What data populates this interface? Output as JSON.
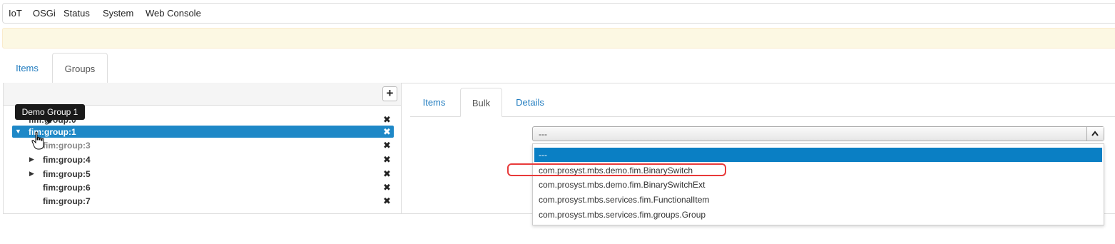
{
  "navbar": {
    "items": [
      {
        "label": "IoT"
      },
      {
        "label": "OSGi"
      },
      {
        "label": "Status"
      },
      {
        "label": "System"
      },
      {
        "label": "Web Console"
      }
    ]
  },
  "main_tabs": [
    {
      "label": "Items",
      "active": false
    },
    {
      "label": "Groups",
      "active": true
    }
  ],
  "tooltip": {
    "text": "Demo Group 1"
  },
  "tree": {
    "rows": [
      {
        "label": "fim:group:0",
        "expanded": false,
        "has_children": false
      },
      {
        "label": "fim:group:1",
        "expanded": true,
        "has_children": true,
        "selected": true
      },
      {
        "label": "fim:group:3",
        "has_children": false,
        "muted": true
      },
      {
        "label": "fim:group:4",
        "has_children": true
      },
      {
        "label": "fim:group:5",
        "has_children": true
      },
      {
        "label": "fim:group:6",
        "has_children": false
      },
      {
        "label": "fim:group:7",
        "has_children": false
      }
    ]
  },
  "sub_tabs": [
    {
      "label": "Items",
      "active": false
    },
    {
      "label": "Bulk",
      "active": true
    },
    {
      "label": "Details",
      "active": false
    }
  ],
  "select": {
    "value": "---"
  },
  "dropdown": {
    "options": [
      {
        "label": "---",
        "selected": true
      },
      {
        "label": "com.prosyst.mbs.demo.fim.BinarySwitch",
        "highlighted": true
      },
      {
        "label": "com.prosyst.mbs.demo.fim.BinarySwitchExt"
      },
      {
        "label": "com.prosyst.mbs.services.fim.FunctionalItem"
      },
      {
        "label": "com.prosyst.mbs.services.fim.groups.Group"
      }
    ]
  },
  "colors": {
    "link": "#1f7bbf",
    "selected_row": "#1e88c7",
    "selected_option": "#0a7fc4",
    "highlight_ring": "#e83a3a",
    "warning_strip": "#fcf8e3"
  }
}
